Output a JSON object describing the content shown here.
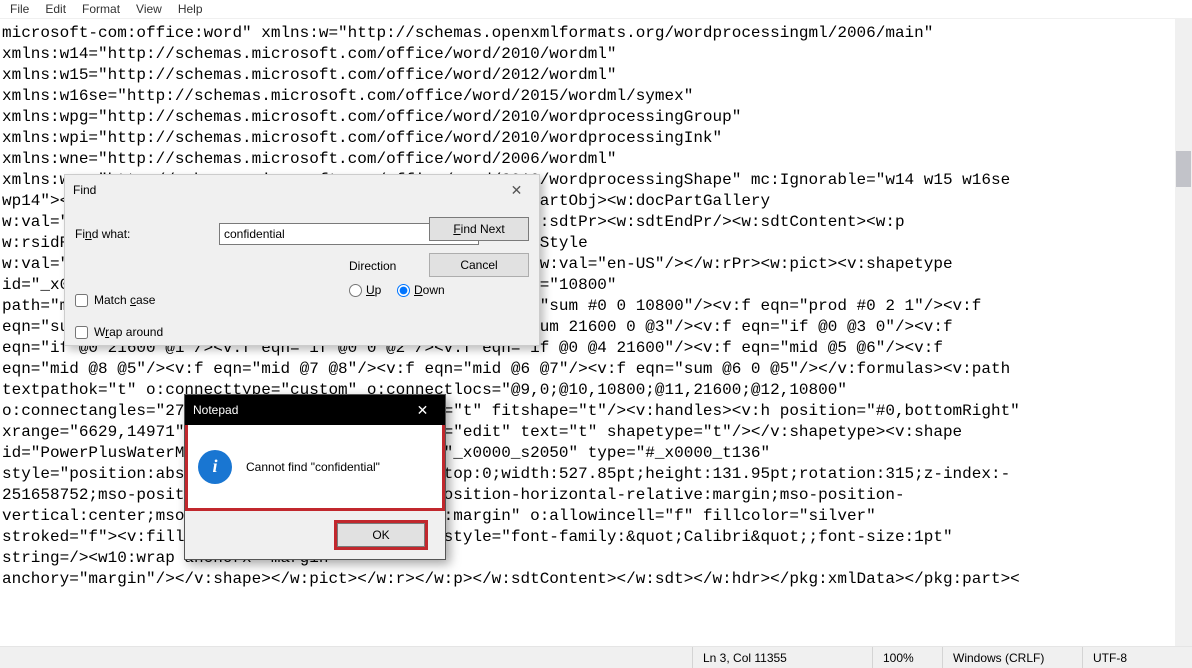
{
  "menu": {
    "items": [
      "File",
      "Edit",
      "Format",
      "View",
      "Help"
    ]
  },
  "editor": {
    "text": "microsoft-com:office:word\" xmlns:w=\"http://schemas.openxmlformats.org/wordprocessingml/2006/main\"\nxmlns:w14=\"http://schemas.microsoft.com/office/word/2010/wordml\"\nxmlns:w15=\"http://schemas.microsoft.com/office/word/2012/wordml\"\nxmlns:w16se=\"http://schemas.microsoft.com/office/word/2015/wordml/symex\"\nxmlns:wpg=\"http://schemas.microsoft.com/office/word/2010/wordprocessingGroup\"\nxmlns:wpi=\"http://schemas.microsoft.com/office/word/2010/wordprocessingInk\"\nxmlns:wne=\"http://schemas.microsoft.com/office/word/2006/wordml\"\nxmlns:wps=\"http://schemas.microsoft.com/office/word/2010/wordprocessingShape\" mc:Ignorable=\"w14 w15 w16se\nwp14\"><w:sdt><w:sdtPr><w:id w:val=\"-1589537429\"/><w:docPartObj><w:docPartGallery\nw:val=\"Watermarks\"/><w:docPartUnique/></w:docPartObj></w:sdtPr><w:sdtEndPr/><w:sdtContent><w:p\nw:rsidR=\"00501EA6\" w:rsidRDefault=\"005C1D1B\"><w:pPr><w:pStyle\nw:val=\"Header\"/></w:pPr><w:r><w:rPr><w:noProof/><w:lang w:val=\"en-US\"/></w:rPr><w:pict><v:shapetype\nid=\"_x0000_t136\" coordsize=\"21600,21600\" o:spt=\"136\" adj=\"10800\"\npath=\"m@7,l@8,m@5,21600l@6,21600e\"><v:formulas><v:f eqn=\"sum #0 0 10800\"/><v:f eqn=\"prod #0 2 1\"/><v:f\neqn=\"sum 21600 0 @1\"/><v:f eqn=\"sum 0 0 @2\"/><v:f eqn=\"sum 21600 0 @3\"/><v:f eqn=\"if @0 @3 0\"/><v:f\neqn=\"if @0 21600 @1\"/><v:f eqn=\"if @0 0 @2\"/><v:f eqn=\"if @0 @4 21600\"/><v:f eqn=\"mid @5 @6\"/><v:f\neqn=\"mid @8 @5\"/><v:f eqn=\"mid @7 @8\"/><v:f eqn=\"mid @6 @7\"/><v:f eqn=\"sum @6 0 @5\"/></v:formulas><v:path\ntextpathok=\"t\" o:connecttype=\"custom\" o:connectlocs=\"@9,0;@10,10800;@11,21600;@12,10800\"\no:connectangles=\"270,180,90,0\"/><v:textpath on=\"t\" fitshape=\"t\"/><v:handles><v:h position=\"#0,bottomRight\"\nxrange=\"6629,14971\"/></v:handles><o:lock v:ext=\"edit\" text=\"t\" shapetype=\"t\"/></v:shapetype><v:shape\nid=\"PowerPlusWaterMarkObject357476642\" o:spid=\"_x0000_s2050\" type=\"#_x0000_t136\"\nstyle=\"position:absolute;margin-left:0;margin-top:0;width:527.85pt;height:131.95pt;rotation:315;z-index:-\n251658752;mso-position-horizontal:center;mso-position-horizontal-relative:margin;mso-position-\nvertical:center;mso-position-vertical-relative:margin\" o:allowincell=\"f\" fillcolor=\"silver\"\nstroked=\"f\"><v:fill opacity=\".5\"/><v:textpath style=\"font-family:&quot;Calibri&quot;;font-size:1pt\"\nstring=/><w10:wrap anchorx=\"margin\"\nanchory=\"margin\"/></v:shape></w:pict></w:r></w:p></w:sdtContent></w:sdt></w:hdr></pkg:xmlData></pkg:part><"
  },
  "find": {
    "title": "Find",
    "find_what_label": "Find what:",
    "value": "confidential",
    "find_next": "Find Next",
    "cancel": "Cancel",
    "direction_label": "Direction",
    "up": "Up",
    "down": "Down",
    "match_case": "Match case",
    "wrap_around": "Wrap around"
  },
  "msg": {
    "title": "Notepad",
    "text": "Cannot find \"confidential\"",
    "ok": "OK"
  },
  "status": {
    "pos": "Ln 3, Col 11355",
    "zoom": "100%",
    "eol": "Windows (CRLF)",
    "encoding": "UTF-8"
  }
}
